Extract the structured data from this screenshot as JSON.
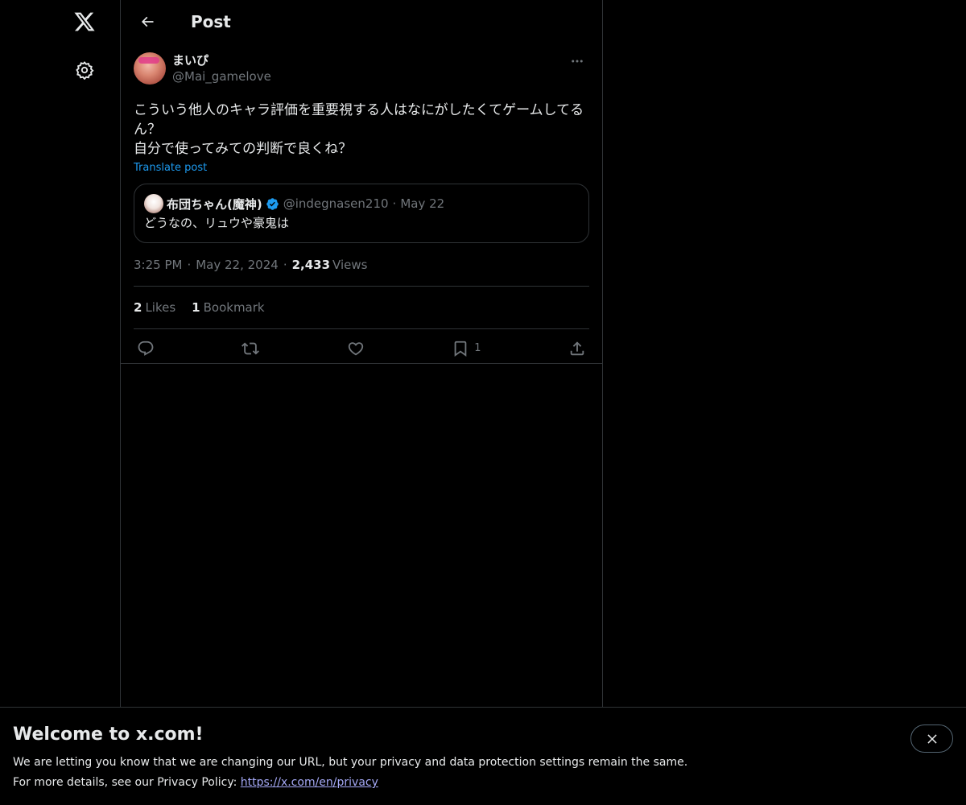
{
  "header": {
    "title": "Post"
  },
  "post": {
    "author": {
      "display_name": "まいぴ",
      "handle": "@Mai_gamelove"
    },
    "text": "こういう他人のキャラ評価を重要視する人はなにがしたくてゲームしてるん？\n自分で使ってみての判断で良くね？",
    "translate_label": "Translate post",
    "quote": {
      "display_name": "布団ちゃん(魔神)",
      "handle": "@indegnasen210",
      "dot": "·",
      "date": "May 22",
      "text": "どうなの、リュウや豪鬼は"
    },
    "meta": {
      "time": "3:25 PM",
      "sep": "·",
      "date": "May 22, 2024",
      "views_count": "2,433",
      "views_label": "Views"
    },
    "stats": {
      "likes_count": "2",
      "likes_label": "Likes",
      "bookmarks_count": "1",
      "bookmarks_label": "Bookmark"
    },
    "actions": {
      "bookmark_count": "1"
    }
  },
  "banner": {
    "title": "Welcome to x.com!",
    "line1": "We are letting you know that we are changing our URL, but your privacy and data protection settings remain the same.",
    "line2_prefix": "For more details, see our Privacy Policy: ",
    "link": "https://x.com/en/privacy"
  },
  "icons": {
    "logo": "x-logo-icon",
    "settings": "gear-icon",
    "back": "arrow-left-icon",
    "more": "more-horizontal-icon",
    "reply": "reply-icon",
    "repost": "repost-icon",
    "like": "heart-icon",
    "bookmark": "bookmark-icon",
    "share": "share-icon",
    "close": "close-icon",
    "verified": "verified-badge-icon"
  },
  "colors": {
    "background": "#000000",
    "text": "#e7e9ea",
    "muted": "#71767b",
    "accent": "#1d9bf0",
    "border": "#2f3336"
  }
}
